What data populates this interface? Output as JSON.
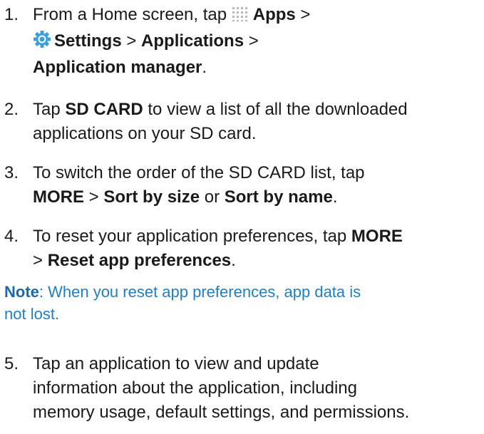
{
  "steps": [
    {
      "number": "1.",
      "lines": [
        {
          "pre": "From a Home screen, tap ",
          "icon": "apps-grid-icon",
          "bold": "Apps",
          "post": " >"
        },
        {
          "icon": "settings-gear-icon",
          "bold": "Settings",
          "mid": " > ",
          "bold2": "Applications",
          "post": " >"
        },
        {
          "bold": "Application manager",
          "post": "."
        }
      ]
    },
    {
      "number": "2.",
      "lines": [
        {
          "pre": "Tap ",
          "bold": "SD CARD",
          "post": " to view a list of all the downloaded"
        },
        {
          "pre": "applications on your SD card."
        }
      ]
    },
    {
      "number": "3.",
      "lines": [
        {
          "pre": "To switch the order of the SD CARD list, tap"
        },
        {
          "bold": "MORE",
          "mid": " > ",
          "bold2": "Sort by size",
          "mid2": " or ",
          "bold3": "Sort by name",
          "post": "."
        }
      ]
    },
    {
      "number": "4.",
      "lines": [
        {
          "pre": "To reset your application preferences, tap ",
          "bold": "MORE"
        },
        {
          "pre": "> ",
          "bold": "Reset app preferences",
          "post": "."
        }
      ]
    },
    {
      "number": "5.",
      "lines": [
        {
          "pre": "Tap an application to view and update"
        },
        {
          "pre": "information about the application, including"
        },
        {
          "pre": "memory usage, default settings, and permissions."
        }
      ]
    }
  ],
  "note": {
    "label": "Note",
    "line1": ": When you reset app preferences, app data is",
    "line2": "not lost."
  },
  "colors": {
    "text": "#1a1a1a",
    "note": "#1f7fc1",
    "gear": "#3aa0d8"
  },
  "icons": {
    "apps": "apps-grid-icon",
    "settings": "settings-gear-icon"
  }
}
